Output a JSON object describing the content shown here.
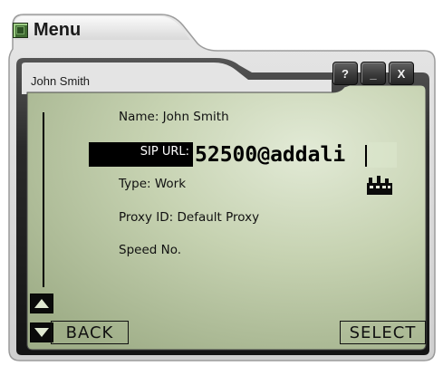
{
  "window": {
    "title": "Menu"
  },
  "header": {
    "contact_name": "John Smith"
  },
  "controls": {
    "help": "?",
    "minimize": "_",
    "close": "X"
  },
  "details": {
    "name": "Name: John Smith",
    "sip_label": "SIP URL:",
    "sip_value": "52500@addali",
    "type": "Type: Work",
    "proxy": "Proxy ID: Default Proxy",
    "speed": "Speed No."
  },
  "softkeys": {
    "back": "BACK",
    "select": "SELECT"
  },
  "colors": {
    "lcd_background": "#bdc9a8",
    "lcd_highlight": "#dfe8d1",
    "frame_dark": "#2f2f2f",
    "frame_light": "#b7b7b7"
  },
  "icons": {
    "menu": "menu-icon",
    "contact_type": "work-building-icon",
    "scroll_up": "arrow-up-icon",
    "scroll_down": "arrow-down-icon"
  }
}
